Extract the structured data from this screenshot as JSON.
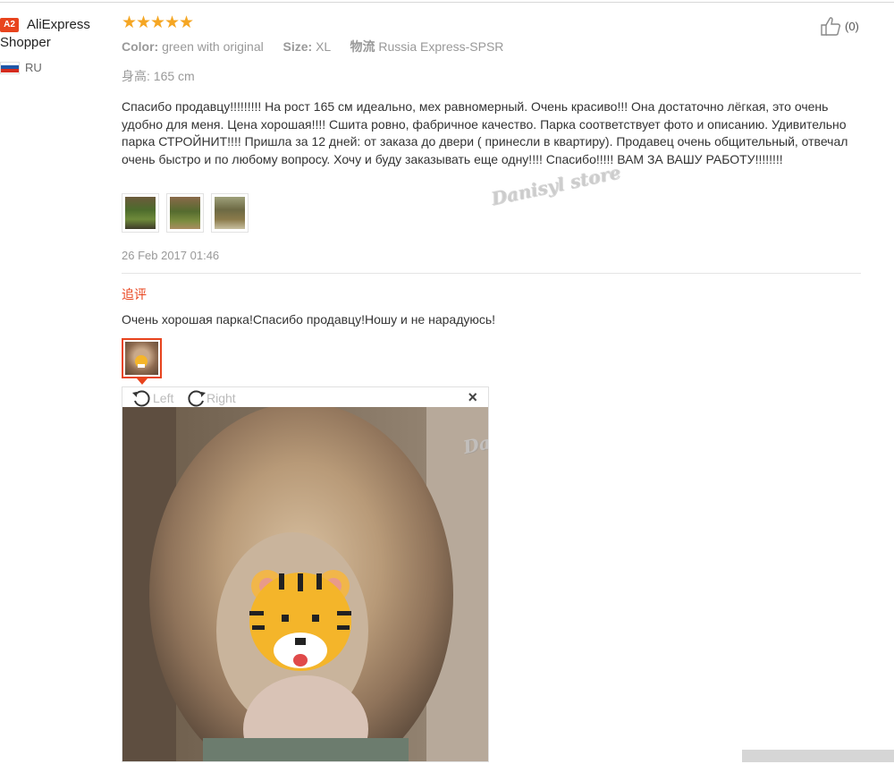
{
  "user": {
    "badge": "A2",
    "name": "AliExpress Shopper",
    "country_code": "RU",
    "flag_colors": [
      "#ffffff",
      "#1f57a8",
      "#d52b1e"
    ]
  },
  "review": {
    "rating": 5,
    "stars": "★★★★★",
    "color_label": "Color:",
    "color_value": "green with original",
    "size_label": "Size:",
    "size_value": "XL",
    "logistics_label": "物流",
    "logistics_value": "Russia Express-SPSR",
    "height_label": "身高:",
    "height_value": "165 cm",
    "text": "Спасибо продавцу!!!!!!!!! На рост 165 см идеально, мех равномерный. Очень красиво!!! Она достаточно лёгкая, это очень удобно для меня. Цена хорошая!!!! Сшита ровно, фабричное качество. Парка соответствует фото и описанию. Удивительно парка СТРОЙНИТ!!!! Пришла за 12 дней: от заказа до двери ( принесли в квартиру). Продавец очень общительный, отвечал очень быстро и по любому вопросу. Хочу и буду заказывать еще одну!!!! Спасибо!!!!! ВАМ ЗА ВАШУ РАБОТУ!!!!!!!!",
    "date": "26 Feb 2017 01:46",
    "like_count": "(0)"
  },
  "additional": {
    "title": "追评",
    "text": "Очень хорошая парка!Спасибо продавцу!Ношу и не нарадуюсь!"
  },
  "viewer": {
    "rotate_left_label": "Left",
    "rotate_right_label": "Right",
    "close_label": "×"
  },
  "watermark": "Danisyl store",
  "colors": {
    "accent": "#e8441e",
    "star": "#f5a623",
    "muted": "#999999"
  }
}
